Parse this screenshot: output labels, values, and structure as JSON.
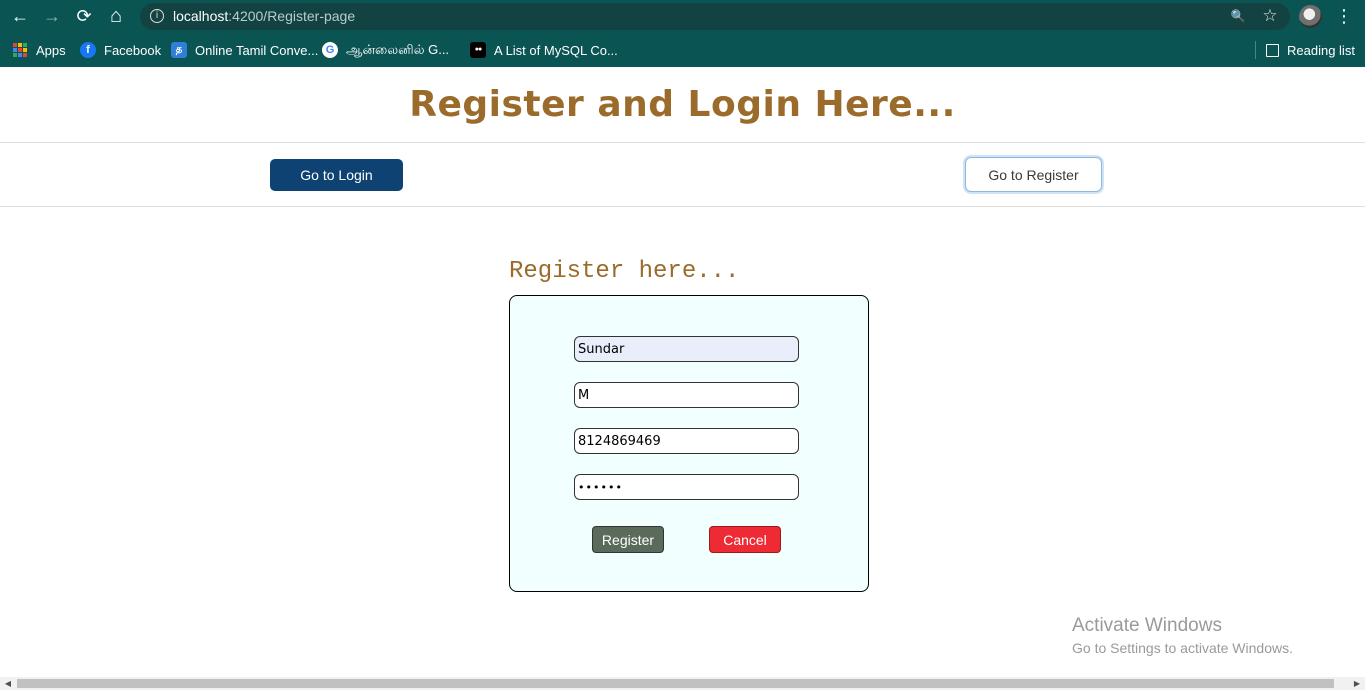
{
  "browser": {
    "url_host": "localhost",
    "url_path": ":4200/Register-page",
    "icons": {
      "back": "←",
      "forward": "→",
      "reload": "⟳",
      "home": "⌂",
      "info": "i",
      "zoom": "🔍",
      "star": "☆",
      "menu": "⋮"
    }
  },
  "bookmarks": {
    "apps": "Apps",
    "items": [
      {
        "label": "Facebook",
        "icon": "f"
      },
      {
        "label": "Online Tamil Conve...",
        "icon": "த"
      },
      {
        "label": "ஆன்லைனில் G...",
        "icon": "G"
      },
      {
        "label": "A List of MySQL Co...",
        "icon": "●●"
      }
    ],
    "reading_list": "Reading list"
  },
  "page": {
    "title": "Register and Login Here...",
    "go_to_login": "Go to Login",
    "go_to_register": "Go to Register"
  },
  "form": {
    "heading": "Register here...",
    "first_name": "Sundar",
    "last_name": "M",
    "phone": "8124869469",
    "password": "••••••",
    "register_label": "Register",
    "cancel_label": "Cancel"
  },
  "watermark": {
    "line1": "Activate Windows",
    "line2": "Go to Settings to activate Windows."
  },
  "scrollbar": {
    "left_arrow": "◀",
    "right_arrow": "▶"
  },
  "colors": {
    "chrome": "#0b5454",
    "title": "#9a6b2a",
    "login_button": "#0d4272",
    "register_button": "#5b6b5b",
    "cancel_button": "#ee2b34",
    "card_bg": "#f1ffff"
  }
}
